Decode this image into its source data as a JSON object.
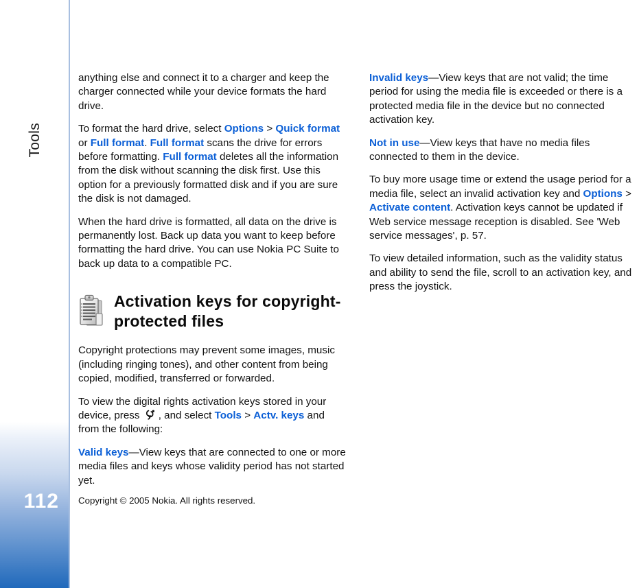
{
  "sidebar": {
    "chapter_label": "Tools",
    "page_number": "112",
    "gradient_top_color": "#ffffff",
    "gradient_bottom_color": "#2069bb",
    "border_color": "#a8bfe0"
  },
  "accent_color": "#0b5fd6",
  "icons": {
    "section_icon": "clipboard-document-icon",
    "navi_key": "nokia-menu-key-icon"
  },
  "left_column": {
    "p1": {
      "text": "anything else and connect it to a charger and keep the charger connected while your device formats the hard drive."
    },
    "p2": {
      "s1": "To format the hard drive, select ",
      "hl1": "Options",
      "s2": " > ",
      "hl2": "Quick format",
      "s3": " or ",
      "hl3": "Full format",
      "s4": ". ",
      "hl4": "Full format",
      "s5": " scans the drive for errors before formatting. ",
      "hl5": "Full format",
      "s6": " deletes all the information from the disk without scanning the disk first. Use this option for a previously formatted disk and if you are sure the disk is not damaged."
    },
    "p3": {
      "text": "When the hard drive is formatted, all data on the drive is permanently lost. Back up data you want to keep before formatting the hard drive. You can use Nokia PC Suite to back up data to a compatible PC."
    },
    "heading": "Activation keys for copyright-protected files",
    "p4": {
      "text": "Copyright protections may prevent some images, music (including ringing tones), and other content from being copied, modified, transferred or forwarded."
    },
    "p5": {
      "s1": "To view the digital rights activation keys stored in your device, press ",
      "s2": ", and select ",
      "hl1": "Tools",
      "s3": " > ",
      "hl2": "Actv. keys",
      "s4": " and from the following:"
    },
    "p6": {
      "hl1": "Valid keys",
      "s1": "—View keys that are connected to one or more media files and keys whose validity period has not started yet."
    }
  },
  "right_column": {
    "p1": {
      "hl1": "Invalid keys",
      "s1": "—View keys that are not valid; the time period for using the media file is exceeded or there is a protected media file in the device but no connected activation key."
    },
    "p2": {
      "hl1": "Not in use",
      "s1": "—View keys that have no media files connected to them in the device."
    },
    "p3": {
      "s1": "To buy more usage time or extend the usage period for a media file, select an invalid activation key and ",
      "hl1": "Options",
      "s2": " > ",
      "hl2": "Activate content",
      "s3": ". Activation keys cannot be updated if Web service message reception is disabled. See 'Web service messages', p. 57."
    },
    "p4": {
      "text": "To view detailed information, such as the validity status and ability to send the file, scroll to an activation key, and press the joystick."
    }
  },
  "footer": {
    "text": "Copyright © 2005 Nokia. All rights reserved."
  }
}
